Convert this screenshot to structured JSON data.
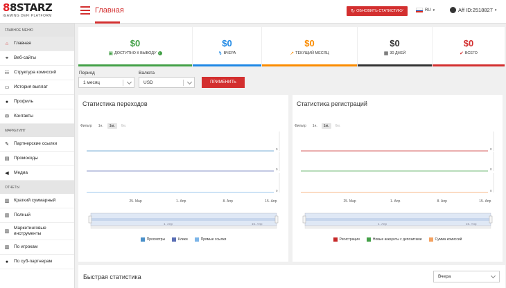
{
  "header": {
    "logo_main_a": "8",
    "logo_main_b": "8",
    "logo_main_c": "STARZ",
    "logo_sub": "iGAMING DEFI PLATFORM",
    "page_title": "Главная",
    "refresh_label": "ОБНОВИТЬ СТАТИСТИКУ",
    "lang": "RU",
    "aff": "Aff ID:2518827",
    "accent": "#d32f2f"
  },
  "sidebar": {
    "sections": [
      {
        "title": "ГЛАВНОЕ МЕНЮ",
        "items": [
          {
            "label": "Главная",
            "icon": "home-icon",
            "active": true
          },
          {
            "label": "Веб-сайты",
            "icon": "link-icon"
          },
          {
            "label": "Структура комиссий",
            "icon": "hierarchy-icon"
          },
          {
            "label": "История выплат",
            "icon": "card-icon"
          },
          {
            "label": "Профиль",
            "icon": "user-icon"
          },
          {
            "label": "Контакты",
            "icon": "envelope-icon"
          }
        ]
      },
      {
        "title": "МАРКЕТИНГ",
        "items": [
          {
            "label": "Партнерские ссылки",
            "icon": "edit-icon"
          },
          {
            "label": "Промокоды",
            "icon": "ticket-icon"
          },
          {
            "label": "Медиа",
            "icon": "megaphone-icon"
          }
        ]
      },
      {
        "title": "ОТЧЕТЫ",
        "items": [
          {
            "label": "Краткий суммарный",
            "icon": "chart-icon"
          },
          {
            "label": "Полный",
            "icon": "chart-icon"
          },
          {
            "label": "Маркетинговые инструменты",
            "icon": "chart-icon"
          },
          {
            "label": "По игрокам",
            "icon": "chart-icon"
          },
          {
            "label": "По суб-партнерам",
            "icon": "users-icon"
          }
        ]
      }
    ]
  },
  "stats": [
    {
      "value": "$0",
      "label": "ДОСТУПНО К ВЫВОДУ",
      "color": "#43a047",
      "icon": "cash-icon"
    },
    {
      "value": "$0",
      "label": "ВЧЕРА",
      "color": "#1e88e5",
      "icon": "bolt-icon"
    },
    {
      "value": "$0",
      "label": "ТЕКУЩИЙ МЕСЯЦ",
      "color": "#fb8c00",
      "icon": "trend-icon"
    },
    {
      "value": "$0",
      "label": "30 ДНЕЙ",
      "color": "#333333",
      "icon": "calendar-icon"
    },
    {
      "value": "$0",
      "label": "ВСЕГО",
      "color": "#d32f2f",
      "icon": "check-icon"
    }
  ],
  "filters": {
    "period_label": "Период",
    "period_value": "1 месяц",
    "currency_label": "Валюта",
    "currency_value": "USD",
    "apply_label": "ПРИМЕНИТЬ"
  },
  "clicks_card": {
    "title": "Статистика переходов",
    "filter_label": "Фильтр",
    "filter_options": [
      "1н.",
      "1м.",
      "6м."
    ],
    "legend": [
      {
        "name": "Просмотры",
        "color": "#4a90c9"
      },
      {
        "name": "Клики",
        "color": "#5b6fb5"
      },
      {
        "name": "Прямые ссылки",
        "color": "#7cb5e8"
      }
    ]
  },
  "reg_card": {
    "title": "Статистика регистраций",
    "filter_label": "Фильтр",
    "filter_options": [
      "1н.",
      "1м.",
      "6м."
    ],
    "legend": [
      {
        "name": "Регистрации",
        "color": "#c62828"
      },
      {
        "name": "Новые аккаунты с депозитами",
        "color": "#43a047"
      },
      {
        "name": "Сумма комиссий",
        "color": "#f4a261"
      }
    ]
  },
  "chart_data": [
    {
      "type": "line",
      "x": [
        "25. Мар",
        "1. Апр",
        "8. Апр",
        "15. Апр"
      ],
      "series": [
        {
          "name": "Просмотры",
          "values": [
            0,
            0,
            0,
            0
          ]
        },
        {
          "name": "Клики",
          "values": [
            0,
            0,
            0,
            0
          ]
        },
        {
          "name": "Прямые ссылки",
          "values": [
            0,
            0,
            0,
            0
          ]
        }
      ],
      "y_labels": [
        "0",
        "0",
        "0"
      ]
    },
    {
      "type": "line",
      "x": [
        "25. Мар",
        "1. Апр",
        "8. Апр",
        "15. Апр"
      ],
      "series": [
        {
          "name": "Регистрации",
          "values": [
            0,
            0,
            0,
            0
          ]
        },
        {
          "name": "Новые аккаунты с депозитами",
          "values": [
            0,
            0,
            0,
            0
          ]
        },
        {
          "name": "Сумма комиссий",
          "values": [
            0,
            0,
            0,
            0
          ]
        }
      ],
      "y_labels": [
        "0",
        "0",
        "0"
      ]
    }
  ],
  "navigator_labels": [
    "1. Апр",
    "15. Апр"
  ],
  "quick": {
    "title": "Быстрая статистика",
    "select_value": "Вчера"
  }
}
